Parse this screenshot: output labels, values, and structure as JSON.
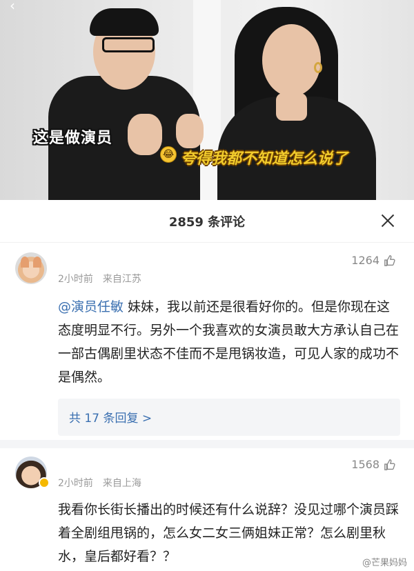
{
  "video": {
    "back_glyph": "‹",
    "caption_left": "这是做演员",
    "caption_right_emoji": "😂",
    "caption_right": "夸得我都不知道怎么说了"
  },
  "sheet": {
    "title": "2859 条评论",
    "close_icon": "close-icon"
  },
  "comments": [
    {
      "time": "2小时前",
      "location": "来自江苏",
      "likes": "1264",
      "mention": "@演员任敏",
      "text": " 妹妹，我以前还是很看好你的。但是你现在这态度明显不行。另外一个我喜欢的女演员敢大方承认自己在一部古偶剧里状态不佳而不是甩锅妆造，可见人家的成功不是偶然。",
      "replies": "共 17 条回复 >"
    },
    {
      "time": "2小时前",
      "location": "来自上海",
      "likes": "1568",
      "text": "我看你长街长播出的时候还有什么说辞？没见过哪个演员踩着全剧组甩锅的，怎么女二女三俩姐妹正常？怎么剧里秋水，皇后都好看？？"
    }
  ],
  "watermark": "@芒果妈妈"
}
